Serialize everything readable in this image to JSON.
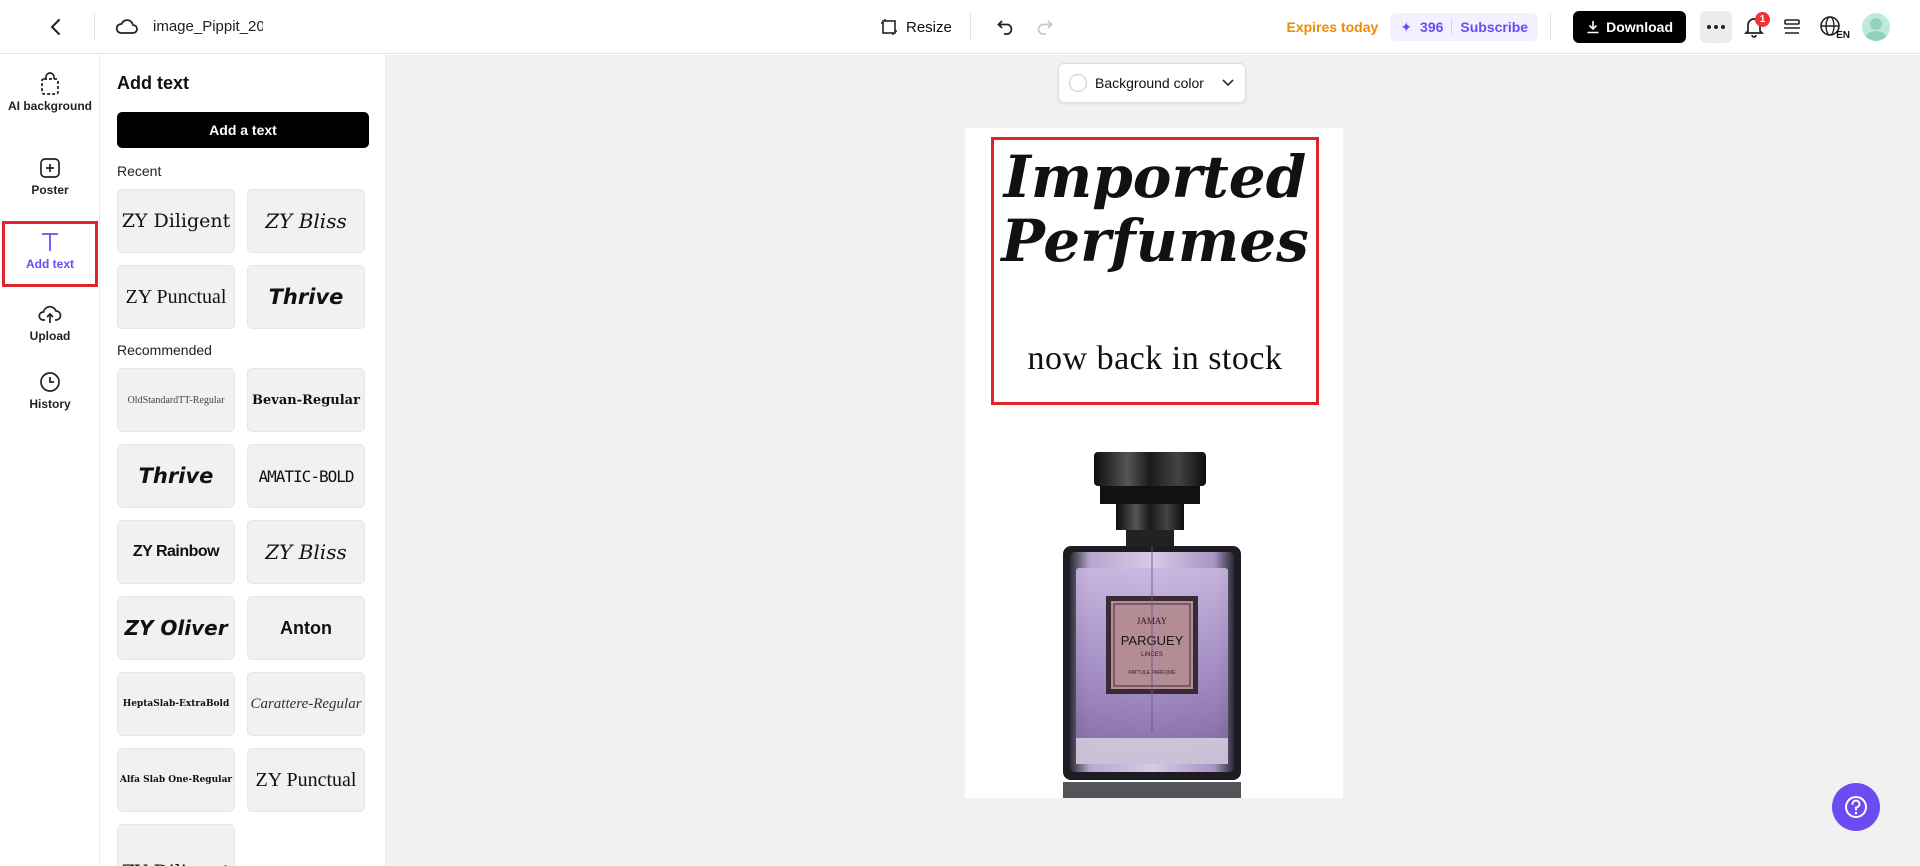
{
  "header": {
    "filename": "image_Pippit_20",
    "resize_label": "Resize",
    "expires_label": "Expires today",
    "credits_value": "396",
    "subscribe_label": "Subscribe",
    "download_label": "Download",
    "notification_count": "1",
    "lang_label": "EN"
  },
  "rail": {
    "items": [
      {
        "label": "AI background"
      },
      {
        "label": "Poster"
      },
      {
        "label": "Add text"
      },
      {
        "label": "Upload"
      },
      {
        "label": "History"
      }
    ],
    "active": "Add text"
  },
  "panel": {
    "title": "Add text",
    "add_button": "Add a text",
    "recent_label": "Recent",
    "recent_fonts": [
      "ZY Diligent",
      "ZY Bliss",
      "ZY Punctual",
      "Thrive"
    ],
    "recommended_label": "Recommended",
    "recommended_fonts": [
      "OldStandardTT-Regular",
      "Bevan-Regular",
      "Thrive",
      "AMATIC-BOLD",
      "ZY Rainbow",
      "ZY Bliss",
      "ZY Oliver",
      "Anton",
      "HeptaSlab-ExtraBold",
      "Carattere-Regular",
      "Alfa Slab One-Regular",
      "ZY Punctual",
      "ZY Diligent"
    ]
  },
  "canvas": {
    "bg_color_label": "Background color",
    "headline_line1": "Imported",
    "headline_line2": "Perfumes",
    "subline": "now back in stock",
    "label_brand": "JAMAY",
    "label_name": "PARGUEY",
    "label_sub": "LINCES",
    "label_type": "PATTULE PARFUME"
  },
  "colors": {
    "accent": "#6a4cf0",
    "expires": "#f08c00",
    "highlight": "#e0242c"
  }
}
